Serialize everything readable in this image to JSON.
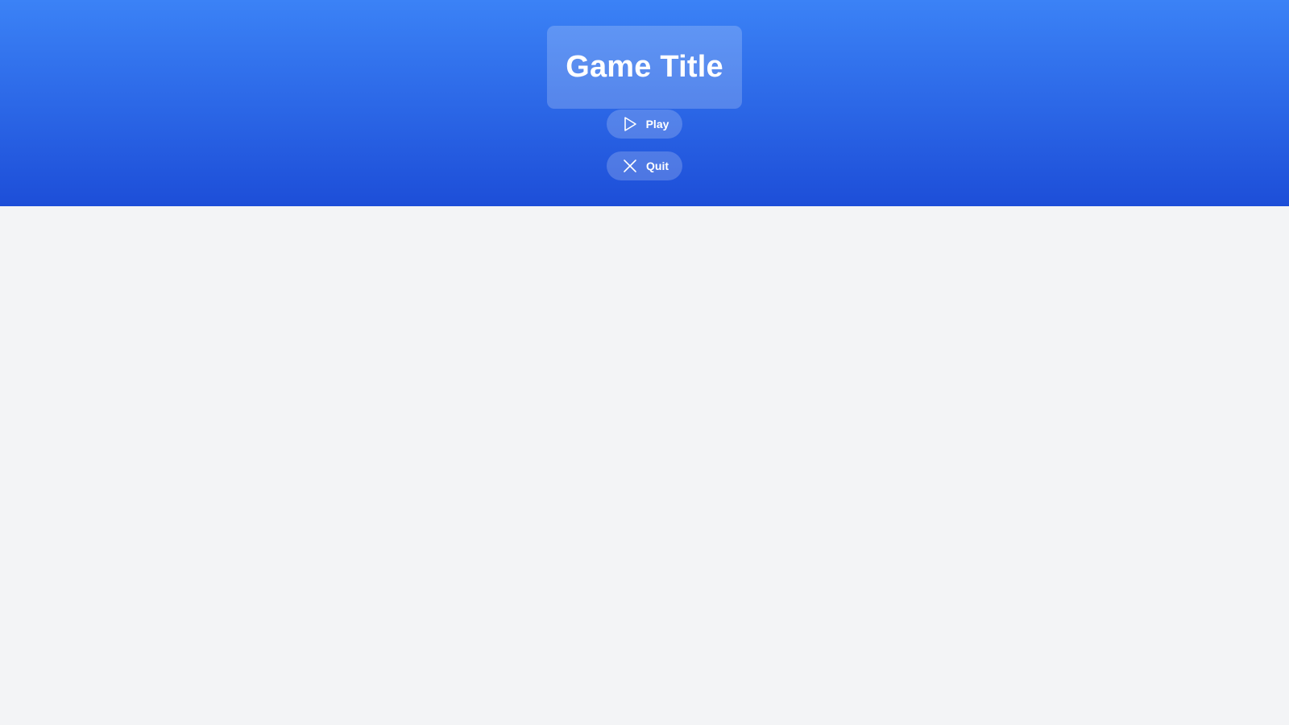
{
  "header": {
    "title": "Game Title"
  },
  "menu": {
    "play": {
      "label": "Play",
      "icon": "play-icon"
    },
    "quit": {
      "label": "Quit",
      "icon": "close-icon"
    }
  },
  "colors": {
    "gradient_top": "#3b82f6",
    "gradient_bottom": "#1d4ed8",
    "page_background": "#f3f4f6",
    "text": "#ffffff"
  }
}
